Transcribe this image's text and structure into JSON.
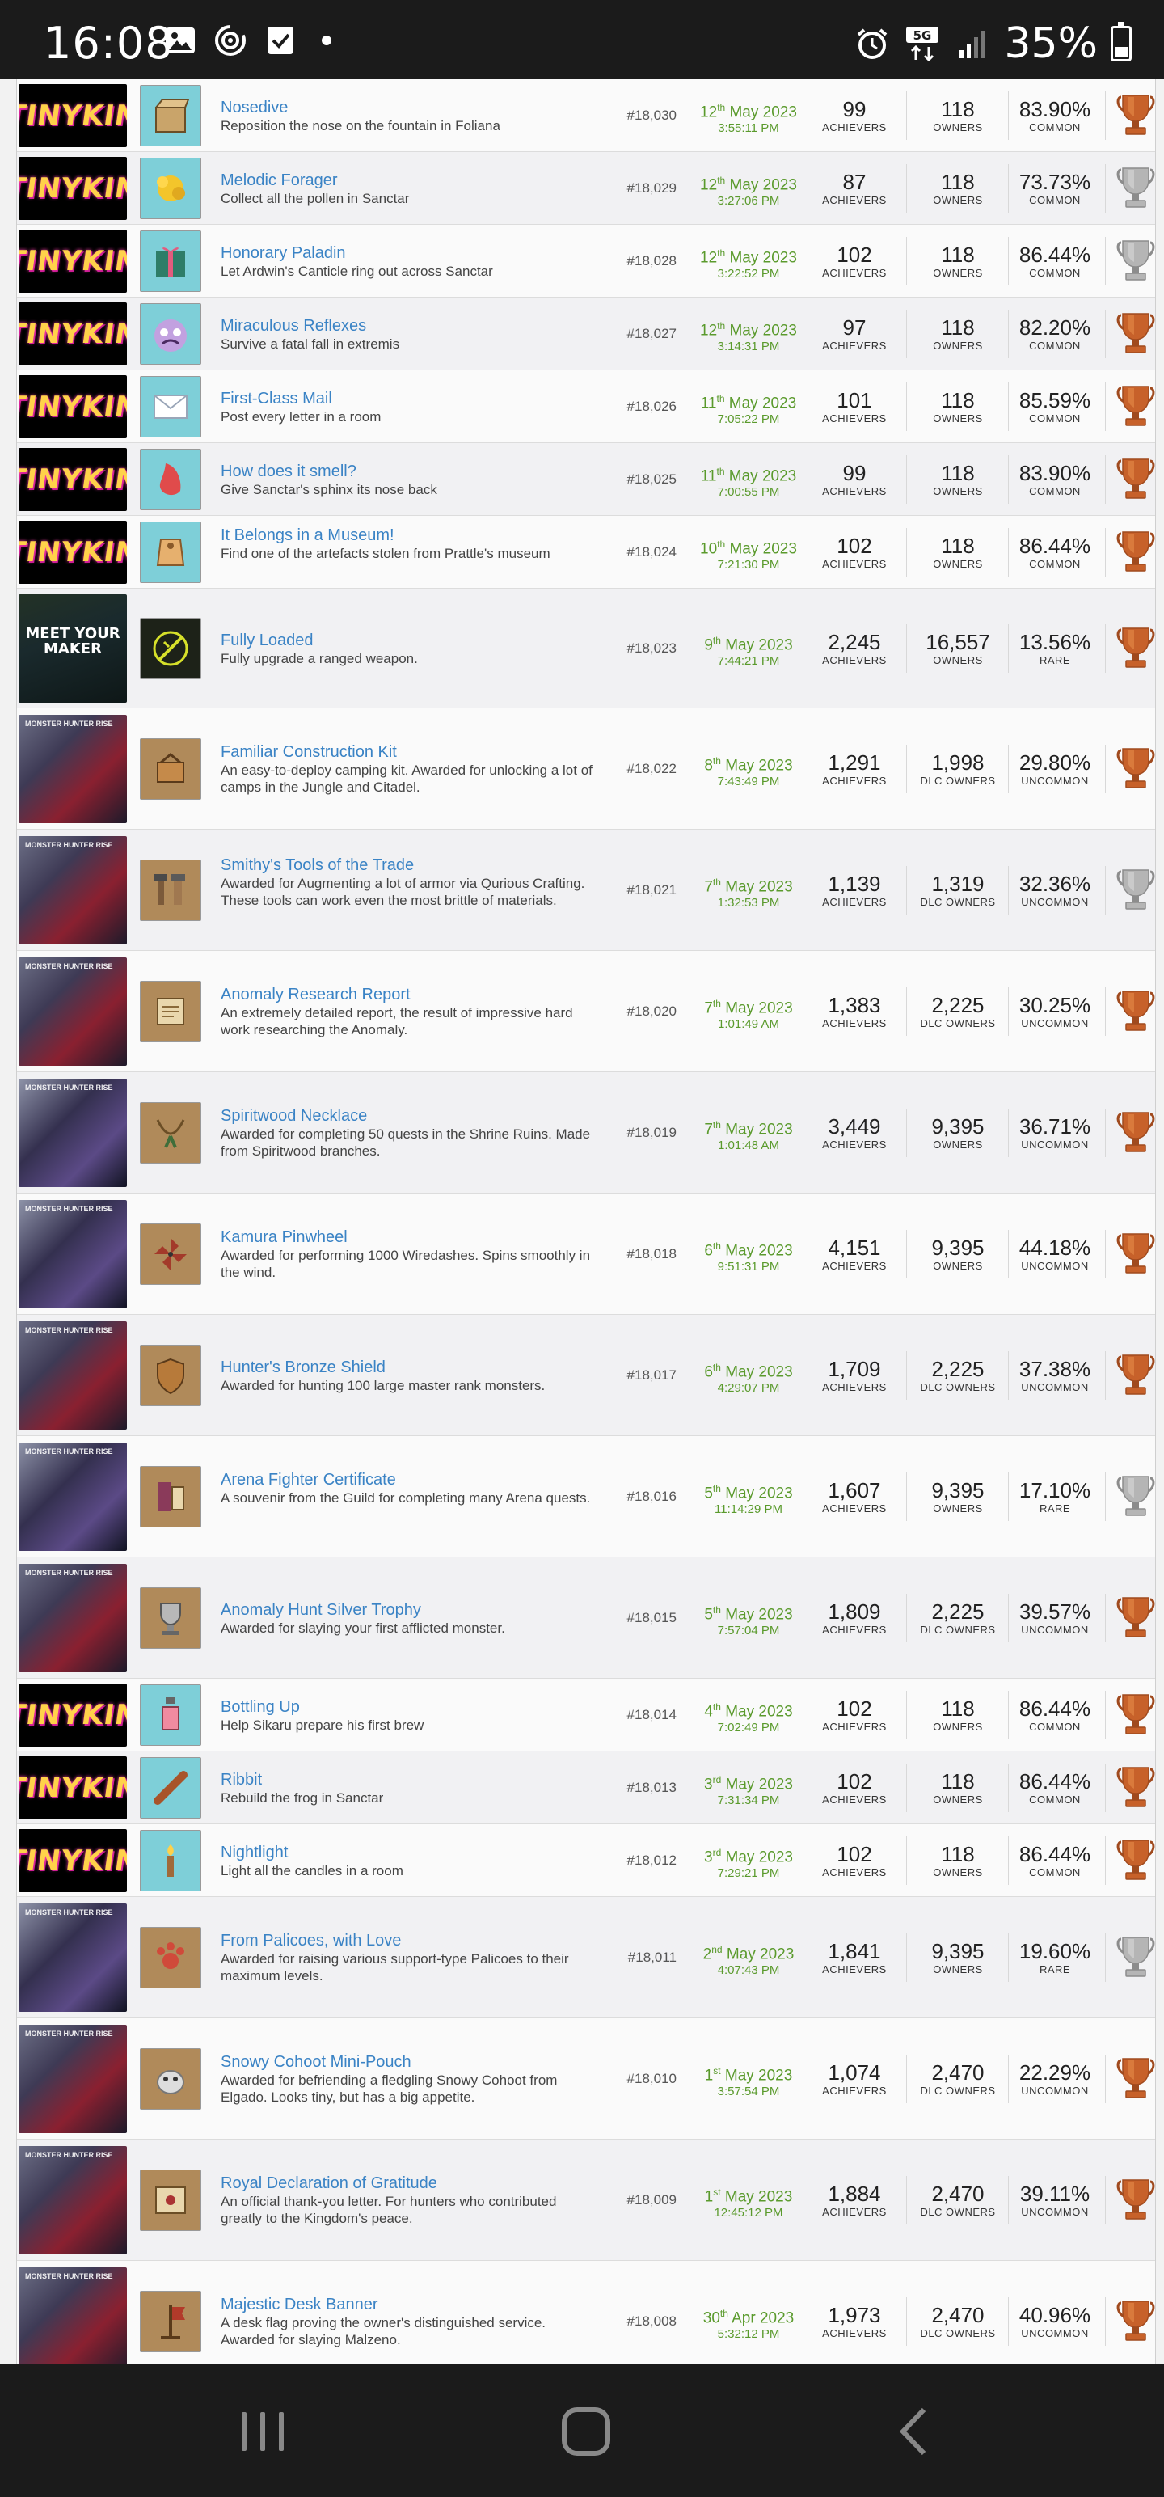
{
  "status_bar": {
    "time": "16:08",
    "battery": "35%",
    "network": "5G",
    "icons": [
      "gallery-icon",
      "data-saver-icon",
      "checkbox-icon",
      "alarm-icon",
      "5g-icon",
      "signal-icon",
      "battery-icon"
    ]
  },
  "colors": {
    "title_link": "#3a83c5",
    "date_green": "#5a9a2c",
    "bronze": "#c7612a",
    "silver": "#9a9a9a"
  },
  "rows": [
    {
      "game": "tinykin",
      "game_label": "TINYKIN",
      "title": "Nosedive",
      "desc": "Reposition the nose on the fountain in Foliana",
      "id": "#18,030",
      "date_day": "12",
      "date_suffix": "th",
      "date_rest": " May 2023",
      "time": "3:55:11 PM",
      "achievers": "99",
      "achievers_label": "ACHIEVERS",
      "owners": "118",
      "owners_label": "OWNERS",
      "pct": "83.90%",
      "rarity": "COMMON",
      "trophy": "bronze",
      "icon": "box"
    },
    {
      "game": "tinykin",
      "game_label": "TINYKIN",
      "title": "Melodic Forager",
      "desc": "Collect all the pollen in Sanctar",
      "id": "#18,029",
      "date_day": "12",
      "date_suffix": "th",
      "date_rest": " May 2023",
      "time": "3:27:06 PM",
      "achievers": "87",
      "achievers_label": "ACHIEVERS",
      "owners": "118",
      "owners_label": "OWNERS",
      "pct": "73.73%",
      "rarity": "COMMON",
      "trophy": "silver",
      "icon": "pollen"
    },
    {
      "game": "tinykin",
      "game_label": "TINYKIN",
      "title": "Honorary Paladin",
      "desc": "Let Ardwin's Canticle ring out across Sanctar",
      "id": "#18,028",
      "date_day": "12",
      "date_suffix": "th",
      "date_rest": " May 2023",
      "time": "3:22:52 PM",
      "achievers": "102",
      "achievers_label": "ACHIEVERS",
      "owners": "118",
      "owners_label": "OWNERS",
      "pct": "86.44%",
      "rarity": "COMMON",
      "trophy": "silver",
      "icon": "gift"
    },
    {
      "game": "tinykin",
      "game_label": "TINYKIN",
      "title": "Miraculous Reflexes",
      "desc": "Survive a fatal fall in extremis",
      "id": "#18,027",
      "date_day": "12",
      "date_suffix": "th",
      "date_rest": " May 2023",
      "time": "3:14:31 PM",
      "achievers": "97",
      "achievers_label": "ACHIEVERS",
      "owners": "118",
      "owners_label": "OWNERS",
      "pct": "82.20%",
      "rarity": "COMMON",
      "trophy": "bronze",
      "icon": "face"
    },
    {
      "game": "tinykin",
      "game_label": "TINYKIN",
      "title": "First-Class Mail",
      "desc": "Post every letter in a room",
      "id": "#18,026",
      "date_day": "11",
      "date_suffix": "th",
      "date_rest": " May 2023",
      "time": "7:05:22 PM",
      "achievers": "101",
      "achievers_label": "ACHIEVERS",
      "owners": "118",
      "owners_label": "OWNERS",
      "pct": "85.59%",
      "rarity": "COMMON",
      "trophy": "bronze",
      "icon": "mail"
    },
    {
      "game": "tinykin",
      "game_label": "TINYKIN",
      "title": "How does it smell?",
      "desc": "Give Sanctar's sphinx its nose back",
      "id": "#18,025",
      "date_day": "11",
      "date_suffix": "th",
      "date_rest": " May 2023",
      "time": "7:00:55 PM",
      "achievers": "99",
      "achievers_label": "ACHIEVERS",
      "owners": "118",
      "owners_label": "OWNERS",
      "pct": "83.90%",
      "rarity": "COMMON",
      "trophy": "bronze",
      "icon": "nose"
    },
    {
      "game": "tinykin",
      "game_label": "TINYKIN",
      "title": "It Belongs in a Museum!",
      "desc": "Find one of the artefacts stolen from Prattle's museum",
      "id": "#18,024",
      "date_day": "10",
      "date_suffix": "th",
      "date_rest": " May 2023",
      "time": "7:21:30 PM",
      "achievers": "102",
      "achievers_label": "ACHIEVERS",
      "owners": "118",
      "owners_label": "OWNERS",
      "pct": "86.44%",
      "rarity": "COMMON",
      "trophy": "bronze",
      "icon": "tag"
    },
    {
      "game": "mym",
      "game_label": "MEET YOUR MAKER",
      "title": "Fully Loaded",
      "desc": "Fully upgrade a ranged weapon.",
      "id": "#18,023",
      "date_day": "9",
      "date_suffix": "th",
      "date_rest": " May 2023",
      "time": "7:44:21 PM",
      "achievers": "2,245",
      "achievers_label": "ACHIEVERS",
      "owners": "16,557",
      "owners_label": "OWNERS",
      "pct": "13.56%",
      "rarity": "RARE",
      "trophy": "bronze",
      "icon": "gun"
    },
    {
      "game": "mh",
      "game_label": "MONSTER HUNTER RISE",
      "title": "Familiar Construction Kit",
      "desc": "An easy-to-deploy camping kit. Awarded for unlocking a lot of camps in the Jungle and Citadel.",
      "id": "#18,022",
      "date_day": "8",
      "date_suffix": "th",
      "date_rest": " May 2023",
      "time": "7:43:49 PM",
      "achievers": "1,291",
      "achievers_label": "ACHIEVERS",
      "owners": "1,998",
      "owners_label": "DLC OWNERS",
      "pct": "29.80%",
      "rarity": "UNCOMMON",
      "trophy": "bronze",
      "icon": "kit"
    },
    {
      "game": "mh",
      "game_label": "MONSTER HUNTER RISE",
      "title": "Smithy's Tools of the Trade",
      "desc": "Awarded for Augmenting a lot of armor via Qurious Crafting. These tools can work even the most brittle of materials.",
      "id": "#18,021",
      "date_day": "7",
      "date_suffix": "th",
      "date_rest": " May 2023",
      "time": "1:32:53 PM",
      "achievers": "1,139",
      "achievers_label": "ACHIEVERS",
      "owners": "1,319",
      "owners_label": "DLC OWNERS",
      "pct": "32.36%",
      "rarity": "UNCOMMON",
      "trophy": "silver",
      "icon": "tools"
    },
    {
      "game": "mh",
      "game_label": "MONSTER HUNTER RISE",
      "title": "Anomaly Research Report",
      "desc": "An extremely detailed report, the result of impressive hard work researching the Anomaly.",
      "id": "#18,020",
      "date_day": "7",
      "date_suffix": "th",
      "date_rest": " May 2023",
      "time": "1:01:49 AM",
      "achievers": "1,383",
      "achievers_label": "ACHIEVERS",
      "owners": "2,225",
      "owners_label": "DLC OWNERS",
      "pct": "30.25%",
      "rarity": "UNCOMMON",
      "trophy": "bronze",
      "icon": "scroll"
    },
    {
      "game": "mh2",
      "game_label": "MONSTER HUNTER RISE",
      "title": "Spiritwood Necklace",
      "desc": "Awarded for completing 50 quests in the Shrine Ruins. Made from Spiritwood branches.",
      "id": "#18,019",
      "date_day": "7",
      "date_suffix": "th",
      "date_rest": " May 2023",
      "time": "1:01:48 AM",
      "achievers": "3,449",
      "achievers_label": "ACHIEVERS",
      "owners": "9,395",
      "owners_label": "OWNERS",
      "pct": "36.71%",
      "rarity": "UNCOMMON",
      "trophy": "bronze",
      "icon": "necklace"
    },
    {
      "game": "mh2",
      "game_label": "MONSTER HUNTER RISE",
      "title": "Kamura Pinwheel",
      "desc": "Awarded for performing 1000 Wiredashes. Spins smoothly in the wind.",
      "id": "#18,018",
      "date_day": "6",
      "date_suffix": "th",
      "date_rest": " May 2023",
      "time": "9:51:31 PM",
      "achievers": "4,151",
      "achievers_label": "ACHIEVERS",
      "owners": "9,395",
      "owners_label": "OWNERS",
      "pct": "44.18%",
      "rarity": "UNCOMMON",
      "trophy": "bronze",
      "icon": "pinwheel"
    },
    {
      "game": "mh",
      "game_label": "MONSTER HUNTER RISE",
      "title": "Hunter's Bronze Shield",
      "desc": "Awarded for hunting 100 large master rank monsters.",
      "id": "#18,017",
      "date_day": "6",
      "date_suffix": "th",
      "date_rest": " May 2023",
      "time": "4:29:07 PM",
      "achievers": "1,709",
      "achievers_label": "ACHIEVERS",
      "owners": "2,225",
      "owners_label": "DLC OWNERS",
      "pct": "37.38%",
      "rarity": "UNCOMMON",
      "trophy": "bronze",
      "icon": "shield"
    },
    {
      "game": "mh2",
      "game_label": "MONSTER HUNTER RISE",
      "title": "Arena Fighter Certificate",
      "desc": "A souvenir from the Guild for completing many Arena quests.",
      "id": "#18,016",
      "date_day": "5",
      "date_suffix": "th",
      "date_rest": " May 2023",
      "time": "11:14:29 PM",
      "achievers": "1,607",
      "achievers_label": "ACHIEVERS",
      "owners": "9,395",
      "owners_label": "OWNERS",
      "pct": "17.10%",
      "rarity": "RARE",
      "trophy": "silver",
      "icon": "certificate"
    },
    {
      "game": "mh",
      "game_label": "MONSTER HUNTER RISE",
      "title": "Anomaly Hunt Silver Trophy",
      "desc": "Awarded for slaying your first afflicted monster.",
      "id": "#18,015",
      "date_day": "5",
      "date_suffix": "th",
      "date_rest": " May 2023",
      "time": "7:57:04 PM",
      "achievers": "1,809",
      "achievers_label": "ACHIEVERS",
      "owners": "2,225",
      "owners_label": "DLC OWNERS",
      "pct": "39.57%",
      "rarity": "UNCOMMON",
      "trophy": "bronze",
      "icon": "cup"
    },
    {
      "game": "tinykin",
      "game_label": "TINYKIN",
      "title": "Bottling Up",
      "desc": "Help Sikaru prepare his first brew",
      "id": "#18,014",
      "date_day": "4",
      "date_suffix": "th",
      "date_rest": " May 2023",
      "time": "7:02:49 PM",
      "achievers": "102",
      "achievers_label": "ACHIEVERS",
      "owners": "118",
      "owners_label": "OWNERS",
      "pct": "86.44%",
      "rarity": "COMMON",
      "trophy": "bronze",
      "icon": "bottle"
    },
    {
      "game": "tinykin",
      "game_label": "TINYKIN",
      "title": "Ribbit",
      "desc": "Rebuild the frog in Sanctar",
      "id": "#18,013",
      "date_day": "3",
      "date_suffix": "rd",
      "date_rest": " May 2023",
      "time": "7:31:34 PM",
      "achievers": "102",
      "achievers_label": "ACHIEVERS",
      "owners": "118",
      "owners_label": "OWNERS",
      "pct": "86.44%",
      "rarity": "COMMON",
      "trophy": "bronze",
      "icon": "stick"
    },
    {
      "game": "tinykin",
      "game_label": "TINYKIN",
      "title": "Nightlight",
      "desc": "Light all the candles in a room",
      "id": "#18,012",
      "date_day": "3",
      "date_suffix": "rd",
      "date_rest": " May 2023",
      "time": "7:29:21 PM",
      "achievers": "102",
      "achievers_label": "ACHIEVERS",
      "owners": "118",
      "owners_label": "OWNERS",
      "pct": "86.44%",
      "rarity": "COMMON",
      "trophy": "bronze",
      "icon": "candle"
    },
    {
      "game": "mh2",
      "game_label": "MONSTER HUNTER RISE",
      "title": "From Palicoes, with Love",
      "desc": "Awarded for raising various support-type Palicoes to their maximum levels.",
      "id": "#18,011",
      "date_day": "2",
      "date_suffix": "nd",
      "date_rest": " May 2023",
      "time": "4:07:43 PM",
      "achievers": "1,841",
      "achievers_label": "ACHIEVERS",
      "owners": "9,395",
      "owners_label": "OWNERS",
      "pct": "19.60%",
      "rarity": "RARE",
      "trophy": "silver",
      "icon": "paw"
    },
    {
      "game": "mh",
      "game_label": "MONSTER HUNTER RISE",
      "title": "Snowy Cohoot Mini-Pouch",
      "desc": "Awarded for befriending a fledgling Snowy Cohoot from Elgado. Looks tiny, but has a big appetite.",
      "id": "#18,010",
      "date_day": "1",
      "date_suffix": "st",
      "date_rest": " May 2023",
      "time": "3:57:54 PM",
      "achievers": "1,074",
      "achievers_label": "ACHIEVERS",
      "owners": "2,470",
      "owners_label": "DLC OWNERS",
      "pct": "22.29%",
      "rarity": "UNCOMMON",
      "trophy": "bronze",
      "icon": "pouch"
    },
    {
      "game": "mh",
      "game_label": "MONSTER HUNTER RISE",
      "title": "Royal Declaration of Gratitude",
      "desc": "An official thank-you letter. For hunters who contributed greatly to the Kingdom's peace.",
      "id": "#18,009",
      "date_day": "1",
      "date_suffix": "st",
      "date_rest": " May 2023",
      "time": "12:45:12 PM",
      "achievers": "1,884",
      "achievers_label": "ACHIEVERS",
      "owners": "2,470",
      "owners_label": "DLC OWNERS",
      "pct": "39.11%",
      "rarity": "UNCOMMON",
      "trophy": "bronze",
      "icon": "letter"
    },
    {
      "game": "mh",
      "game_label": "MONSTER HUNTER RISE",
      "title": "Majestic Desk Banner",
      "desc": "A desk flag proving the owner's distinguished service. Awarded for slaying Malzeno.",
      "id": "#18,008",
      "date_day": "30",
      "date_suffix": "th",
      "date_rest": " Apr 2023",
      "time": "5:32:12 PM",
      "achievers": "1,973",
      "achievers_label": "ACHIEVERS",
      "owners": "2,470",
      "owners_label": "DLC OWNERS",
      "pct": "40.96%",
      "rarity": "UNCOMMON",
      "trophy": "bronze",
      "icon": "banner"
    }
  ],
  "nav_bar": {
    "buttons": [
      "recents-icon",
      "home-icon",
      "back-icon"
    ]
  }
}
